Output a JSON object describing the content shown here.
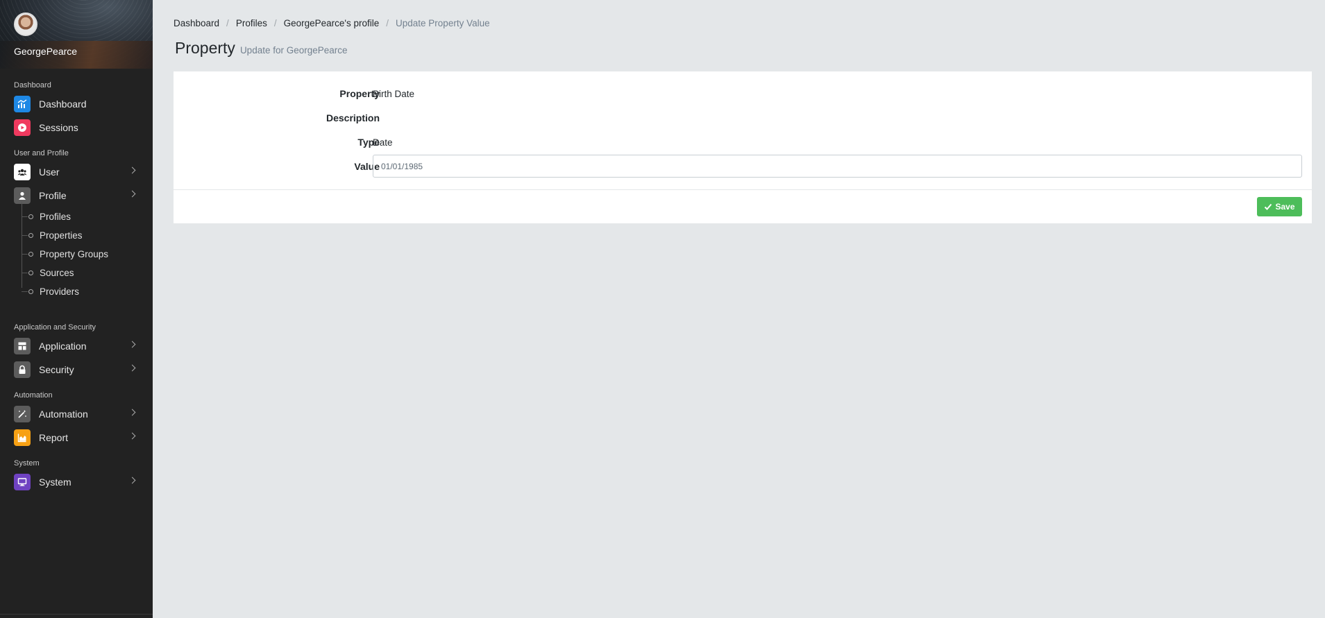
{
  "user": {
    "name": "GeorgePearce"
  },
  "sidebar": {
    "sections": {
      "dashboard": "Dashboard",
      "user_profile": "User and Profile",
      "app_security": "Application and Security",
      "automation": "Automation",
      "system": "System"
    },
    "items": {
      "dashboard": "Dashboard",
      "sessions": "Sessions",
      "user": "User",
      "profile": "Profile",
      "application": "Application",
      "security": "Security",
      "automation": "Automation",
      "report": "Report",
      "system": "System"
    },
    "profile_sub": [
      "Profiles",
      "Properties",
      "Property Groups",
      "Sources",
      "Providers"
    ],
    "icon_colors": {
      "dashboard": "#1e88e5",
      "sessions": "#f03a5f",
      "user": "#ffffff",
      "profile": "#5c5c5c",
      "application": "#5c5c5c",
      "security": "#5c5c5c",
      "automation": "#5c5c5c",
      "report": "#f7a114",
      "system": "#6f42c1"
    }
  },
  "breadcrumb": [
    "Dashboard",
    "Profiles",
    "GeorgePearce's profile",
    "Update Property Value"
  ],
  "header": {
    "title": "Property",
    "subtitle": "Update for GeorgePearce"
  },
  "form": {
    "property_label": "Property",
    "property_value": "Birth Date",
    "description_label": "Description",
    "description_value": "",
    "type_label": "Type",
    "type_value": "Date",
    "value_label": "Value",
    "value_input": "01/01/1985"
  },
  "actions": {
    "save_label": "Save",
    "save_color": "#4dbd5a"
  }
}
